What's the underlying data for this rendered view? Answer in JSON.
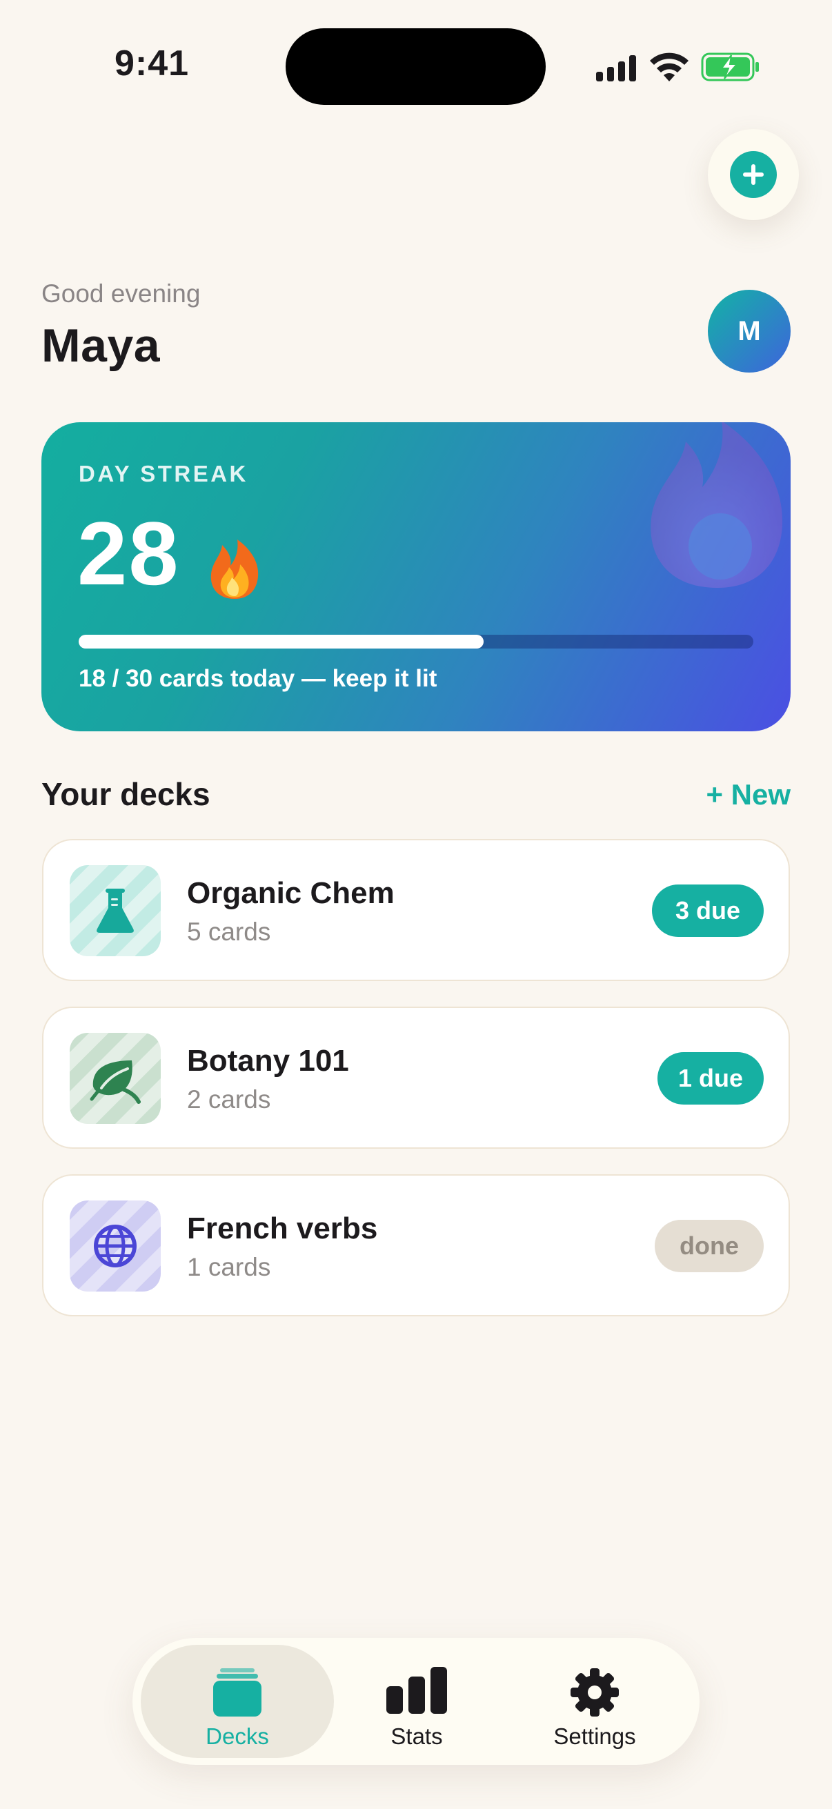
{
  "status_bar": {
    "time": "9:41"
  },
  "header": {
    "greeting": "Good evening",
    "name": "Maya",
    "avatar_initial": "M"
  },
  "streak": {
    "label": "DAY STREAK",
    "count": "28",
    "progress_done": 18,
    "progress_total": 30,
    "progress_text": "18 / 30 cards today — keep it lit"
  },
  "decks_section": {
    "title": "Your decks",
    "new_label": "+ New"
  },
  "decks": [
    {
      "name": "Organic Chem",
      "count": "5 cards",
      "badge": "3 due",
      "icon": "flask-icon",
      "badge_status": "due"
    },
    {
      "name": "Botany 101",
      "count": "2 cards",
      "badge": "1 due",
      "icon": "leaf-icon",
      "badge_status": "due"
    },
    {
      "name": "French verbs",
      "count": "1 cards",
      "badge": "done",
      "icon": "globe-icon",
      "badge_status": "done"
    }
  ],
  "tabs": [
    {
      "label": "Decks",
      "icon": "cards-icon",
      "active": true
    },
    {
      "label": "Stats",
      "icon": "bar-chart-icon",
      "active": false
    },
    {
      "label": "Settings",
      "icon": "gear-icon",
      "active": false
    }
  ],
  "colors": {
    "accent": "#16b0a2",
    "background": "#faf6f0",
    "streak_gradient_start": "#14aea0",
    "streak_gradient_end": "#4b4fe3",
    "done_badge": "#e5ded3"
  }
}
